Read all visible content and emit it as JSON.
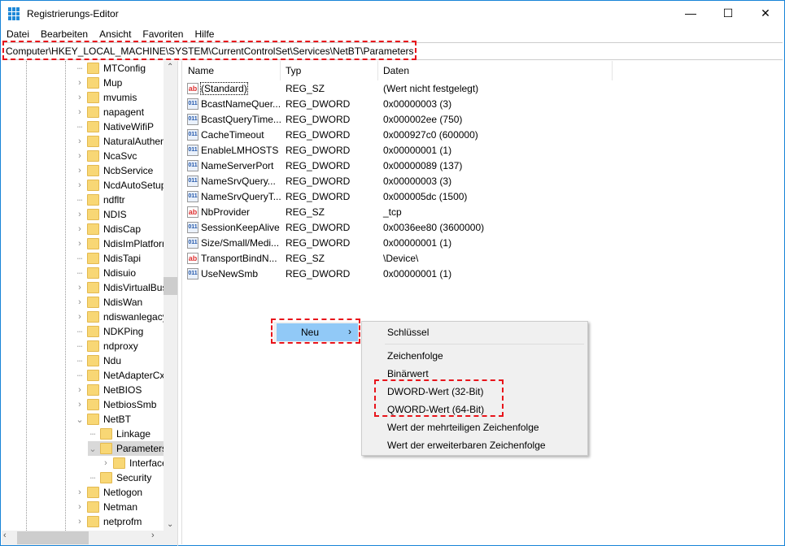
{
  "window": {
    "title": "Registrierungs-Editor",
    "controls": [
      "minimize",
      "maximize",
      "close"
    ]
  },
  "menu": [
    "Datei",
    "Bearbeiten",
    "Ansicht",
    "Favoriten",
    "Hilfe"
  ],
  "address": "Computer\\HKEY_LOCAL_MACHINE\\SYSTEM\\CurrentControlSet\\Services\\NetBT\\Parameters",
  "tree": [
    {
      "label": "MTConfig",
      "level": 0,
      "exp": "leaf"
    },
    {
      "label": "Mup",
      "level": 0,
      "exp": "closed"
    },
    {
      "label": "mvumis",
      "level": 0,
      "exp": "closed"
    },
    {
      "label": "napagent",
      "level": 0,
      "exp": "closed"
    },
    {
      "label": "NativeWifiP",
      "level": 0,
      "exp": "leaf"
    },
    {
      "label": "NaturalAuthen",
      "level": 0,
      "exp": "closed"
    },
    {
      "label": "NcaSvc",
      "level": 0,
      "exp": "closed"
    },
    {
      "label": "NcbService",
      "level": 0,
      "exp": "closed"
    },
    {
      "label": "NcdAutoSetup",
      "level": 0,
      "exp": "closed"
    },
    {
      "label": "ndfltr",
      "level": 0,
      "exp": "leaf"
    },
    {
      "label": "NDIS",
      "level": 0,
      "exp": "closed"
    },
    {
      "label": "NdisCap",
      "level": 0,
      "exp": "closed"
    },
    {
      "label": "NdisImPlatform",
      "level": 0,
      "exp": "closed"
    },
    {
      "label": "NdisTapi",
      "level": 0,
      "exp": "leaf"
    },
    {
      "label": "Ndisuio",
      "level": 0,
      "exp": "leaf"
    },
    {
      "label": "NdisVirtualBus",
      "level": 0,
      "exp": "closed"
    },
    {
      "label": "NdisWan",
      "level": 0,
      "exp": "closed"
    },
    {
      "label": "ndiswanlegacy",
      "level": 0,
      "exp": "closed"
    },
    {
      "label": "NDKPing",
      "level": 0,
      "exp": "leaf"
    },
    {
      "label": "ndproxy",
      "level": 0,
      "exp": "leaf"
    },
    {
      "label": "Ndu",
      "level": 0,
      "exp": "leaf"
    },
    {
      "label": "NetAdapterCx",
      "level": 0,
      "exp": "leaf"
    },
    {
      "label": "NetBIOS",
      "level": 0,
      "exp": "closed"
    },
    {
      "label": "NetbiosSmb",
      "level": 0,
      "exp": "closed"
    },
    {
      "label": "NetBT",
      "level": 0,
      "exp": "open"
    },
    {
      "label": "Linkage",
      "level": 1,
      "exp": "leaf"
    },
    {
      "label": "Parameters",
      "level": 1,
      "exp": "open",
      "selected": true
    },
    {
      "label": "Interfaces",
      "level": 2,
      "exp": "closed"
    },
    {
      "label": "Security",
      "level": 1,
      "exp": "leaf"
    },
    {
      "label": "Netlogon",
      "level": 0,
      "exp": "closed"
    },
    {
      "label": "Netman",
      "level": 0,
      "exp": "closed"
    },
    {
      "label": "netprofm",
      "level": 0,
      "exp": "closed"
    }
  ],
  "columns": [
    "Name",
    "Typ",
    "Daten"
  ],
  "values": [
    {
      "name": "(Standard)",
      "type": "REG_SZ",
      "data": "(Wert nicht festgelegt)",
      "icon": "string"
    },
    {
      "name": "BcastNameQuer...",
      "type": "REG_DWORD",
      "data": "0x00000003 (3)",
      "icon": "dword"
    },
    {
      "name": "BcastQueryTime...",
      "type": "REG_DWORD",
      "data": "0x000002ee (750)",
      "icon": "dword"
    },
    {
      "name": "CacheTimeout",
      "type": "REG_DWORD",
      "data": "0x000927c0 (600000)",
      "icon": "dword"
    },
    {
      "name": "EnableLMHOSTS",
      "type": "REG_DWORD",
      "data": "0x00000001 (1)",
      "icon": "dword"
    },
    {
      "name": "NameServerPort",
      "type": "REG_DWORD",
      "data": "0x00000089 (137)",
      "icon": "dword"
    },
    {
      "name": "NameSrvQuery...",
      "type": "REG_DWORD",
      "data": "0x00000003 (3)",
      "icon": "dword"
    },
    {
      "name": "NameSrvQueryT...",
      "type": "REG_DWORD",
      "data": "0x000005dc (1500)",
      "icon": "dword"
    },
    {
      "name": "NbProvider",
      "type": "REG_SZ",
      "data": "_tcp",
      "icon": "string"
    },
    {
      "name": "SessionKeepAlive",
      "type": "REG_DWORD",
      "data": "0x0036ee80 (3600000)",
      "icon": "dword"
    },
    {
      "name": "Size/Small/Medi...",
      "type": "REG_DWORD",
      "data": "0x00000001 (1)",
      "icon": "dword"
    },
    {
      "name": "TransportBindN...",
      "type": "REG_SZ",
      "data": "\\Device\\",
      "icon": "string"
    },
    {
      "name": "UseNewSmb",
      "type": "REG_DWORD",
      "data": "0x00000001 (1)",
      "icon": "dword"
    }
  ],
  "context_menu": {
    "parent": "Neu",
    "items": [
      "Schlüssel",
      "Zeichenfolge",
      "Binärwert",
      "DWORD-Wert (32-Bit)",
      "QWORD-Wert (64-Bit)",
      "Wert der mehrteiligen Zeichenfolge",
      "Wert der erweiterbaren Zeichenfolge"
    ]
  },
  "icons": {
    "string": "ab",
    "dword": "011"
  },
  "colors": {
    "highlight": "#e8141b",
    "menu_hover": "#91c9f7"
  }
}
